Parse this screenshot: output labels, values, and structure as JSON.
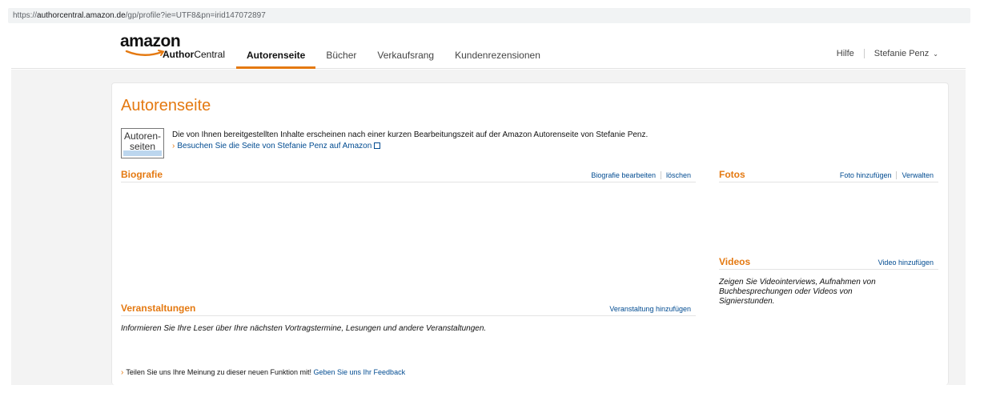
{
  "browser": {
    "url_prefix": "https://",
    "url_host": "authorcentral.amazon.de",
    "url_path": "/gp/profile?ie=UTF8&pn=irid147072897"
  },
  "header": {
    "logo_word": "amazon",
    "logo_sub_bold": "Author",
    "logo_sub_rest": "Central",
    "tabs": [
      {
        "label": "Autorenseite",
        "active": true
      },
      {
        "label": "Bücher",
        "active": false
      },
      {
        "label": "Verkaufsrang",
        "active": false
      },
      {
        "label": "Kundenrezensionen",
        "active": false
      }
    ],
    "help": "Hilfe",
    "user": "Stefanie Penz",
    "user_chevron": "⌄"
  },
  "page": {
    "title": "Autorenseite",
    "badge_line1": "Autoren-",
    "badge_line2": "seiten",
    "info_text": "Die von Ihnen bereitgestellten Inhalte erscheinen nach einer kurzen Bearbeitungszeit auf der Amazon Autorenseite von Stefanie Penz.",
    "info_link": "Besuchen Sie die Seite von Stefanie Penz auf Amazon"
  },
  "biografie": {
    "title": "Biografie",
    "edit_link": "Biografie bearbeiten",
    "delete_link": "löschen"
  },
  "fotos": {
    "title": "Fotos",
    "add_link": "Foto hinzufügen",
    "manage_link": "Verwalten"
  },
  "videos": {
    "title": "Videos",
    "add_link": "Video hinzufügen",
    "desc_line1": "Zeigen Sie Videointerviews, Aufnahmen von",
    "desc_line2": "Buchbesprechungen oder Videos von",
    "desc_line3": "Signierstunden."
  },
  "veranstaltungen": {
    "title": "Veranstaltungen",
    "add_link": "Veranstaltung hinzufügen",
    "desc": "Informieren Sie Ihre Leser über Ihre nächsten Vortragstermine, Lesungen und andere Veranstaltungen."
  },
  "feedback": {
    "text": "Teilen Sie uns Ihre Meinung zu dieser neuen Funktion mit!",
    "link": "Geben Sie uns Ihr Feedback"
  },
  "colors": {
    "accent": "#e47911",
    "link": "#004b91",
    "background": "#f3f3f3"
  },
  "icons": [
    "arrow-right-icon",
    "external-link-icon",
    "chevron-down-icon"
  ]
}
